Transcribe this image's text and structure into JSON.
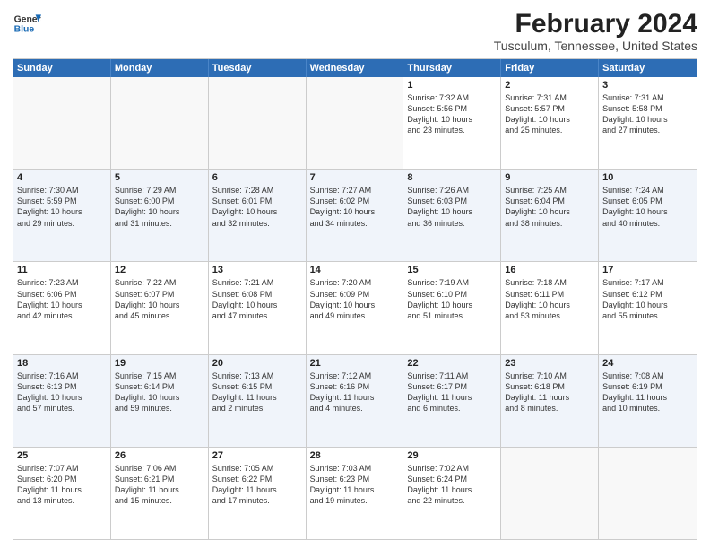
{
  "logo": {
    "line1": "General",
    "line2": "Blue"
  },
  "title": "February 2024",
  "subtitle": "Tusculum, Tennessee, United States",
  "days_of_week": [
    "Sunday",
    "Monday",
    "Tuesday",
    "Wednesday",
    "Thursday",
    "Friday",
    "Saturday"
  ],
  "rows": [
    {
      "cells": [
        {
          "day": "",
          "info": ""
        },
        {
          "day": "",
          "info": ""
        },
        {
          "day": "",
          "info": ""
        },
        {
          "day": "",
          "info": ""
        },
        {
          "day": "1",
          "info": "Sunrise: 7:32 AM\nSunset: 5:56 PM\nDaylight: 10 hours\nand 23 minutes."
        },
        {
          "day": "2",
          "info": "Sunrise: 7:31 AM\nSunset: 5:57 PM\nDaylight: 10 hours\nand 25 minutes."
        },
        {
          "day": "3",
          "info": "Sunrise: 7:31 AM\nSunset: 5:58 PM\nDaylight: 10 hours\nand 27 minutes."
        }
      ]
    },
    {
      "cells": [
        {
          "day": "4",
          "info": "Sunrise: 7:30 AM\nSunset: 5:59 PM\nDaylight: 10 hours\nand 29 minutes."
        },
        {
          "day": "5",
          "info": "Sunrise: 7:29 AM\nSunset: 6:00 PM\nDaylight: 10 hours\nand 31 minutes."
        },
        {
          "day": "6",
          "info": "Sunrise: 7:28 AM\nSunset: 6:01 PM\nDaylight: 10 hours\nand 32 minutes."
        },
        {
          "day": "7",
          "info": "Sunrise: 7:27 AM\nSunset: 6:02 PM\nDaylight: 10 hours\nand 34 minutes."
        },
        {
          "day": "8",
          "info": "Sunrise: 7:26 AM\nSunset: 6:03 PM\nDaylight: 10 hours\nand 36 minutes."
        },
        {
          "day": "9",
          "info": "Sunrise: 7:25 AM\nSunset: 6:04 PM\nDaylight: 10 hours\nand 38 minutes."
        },
        {
          "day": "10",
          "info": "Sunrise: 7:24 AM\nSunset: 6:05 PM\nDaylight: 10 hours\nand 40 minutes."
        }
      ]
    },
    {
      "cells": [
        {
          "day": "11",
          "info": "Sunrise: 7:23 AM\nSunset: 6:06 PM\nDaylight: 10 hours\nand 42 minutes."
        },
        {
          "day": "12",
          "info": "Sunrise: 7:22 AM\nSunset: 6:07 PM\nDaylight: 10 hours\nand 45 minutes."
        },
        {
          "day": "13",
          "info": "Sunrise: 7:21 AM\nSunset: 6:08 PM\nDaylight: 10 hours\nand 47 minutes."
        },
        {
          "day": "14",
          "info": "Sunrise: 7:20 AM\nSunset: 6:09 PM\nDaylight: 10 hours\nand 49 minutes."
        },
        {
          "day": "15",
          "info": "Sunrise: 7:19 AM\nSunset: 6:10 PM\nDaylight: 10 hours\nand 51 minutes."
        },
        {
          "day": "16",
          "info": "Sunrise: 7:18 AM\nSunset: 6:11 PM\nDaylight: 10 hours\nand 53 minutes."
        },
        {
          "day": "17",
          "info": "Sunrise: 7:17 AM\nSunset: 6:12 PM\nDaylight: 10 hours\nand 55 minutes."
        }
      ]
    },
    {
      "cells": [
        {
          "day": "18",
          "info": "Sunrise: 7:16 AM\nSunset: 6:13 PM\nDaylight: 10 hours\nand 57 minutes."
        },
        {
          "day": "19",
          "info": "Sunrise: 7:15 AM\nSunset: 6:14 PM\nDaylight: 10 hours\nand 59 minutes."
        },
        {
          "day": "20",
          "info": "Sunrise: 7:13 AM\nSunset: 6:15 PM\nDaylight: 11 hours\nand 2 minutes."
        },
        {
          "day": "21",
          "info": "Sunrise: 7:12 AM\nSunset: 6:16 PM\nDaylight: 11 hours\nand 4 minutes."
        },
        {
          "day": "22",
          "info": "Sunrise: 7:11 AM\nSunset: 6:17 PM\nDaylight: 11 hours\nand 6 minutes."
        },
        {
          "day": "23",
          "info": "Sunrise: 7:10 AM\nSunset: 6:18 PM\nDaylight: 11 hours\nand 8 minutes."
        },
        {
          "day": "24",
          "info": "Sunrise: 7:08 AM\nSunset: 6:19 PM\nDaylight: 11 hours\nand 10 minutes."
        }
      ]
    },
    {
      "cells": [
        {
          "day": "25",
          "info": "Sunrise: 7:07 AM\nSunset: 6:20 PM\nDaylight: 11 hours\nand 13 minutes."
        },
        {
          "day": "26",
          "info": "Sunrise: 7:06 AM\nSunset: 6:21 PM\nDaylight: 11 hours\nand 15 minutes."
        },
        {
          "day": "27",
          "info": "Sunrise: 7:05 AM\nSunset: 6:22 PM\nDaylight: 11 hours\nand 17 minutes."
        },
        {
          "day": "28",
          "info": "Sunrise: 7:03 AM\nSunset: 6:23 PM\nDaylight: 11 hours\nand 19 minutes."
        },
        {
          "day": "29",
          "info": "Sunrise: 7:02 AM\nSunset: 6:24 PM\nDaylight: 11 hours\nand 22 minutes."
        },
        {
          "day": "",
          "info": ""
        },
        {
          "day": "",
          "info": ""
        }
      ]
    }
  ]
}
